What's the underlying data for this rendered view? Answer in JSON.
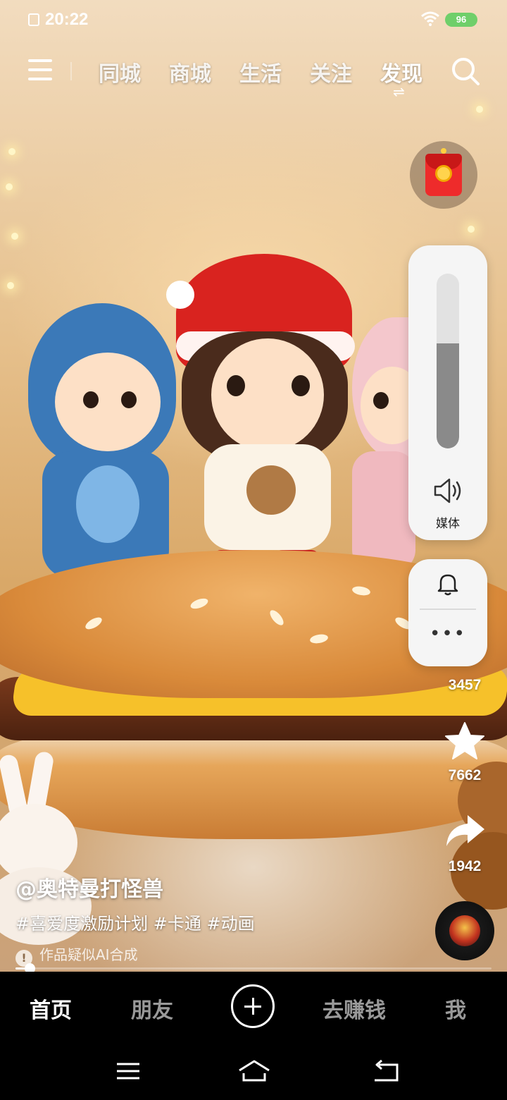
{
  "status_bar": {
    "time": "20:22",
    "battery": "96"
  },
  "top_nav": {
    "tabs": [
      {
        "label": "同城"
      },
      {
        "label": "商城"
      },
      {
        "label": "生活"
      },
      {
        "label": "关注"
      },
      {
        "label": "发现"
      }
    ],
    "active_tab": "发现"
  },
  "volume_panel": {
    "label": "媒体",
    "level": 0.6
  },
  "actions": {
    "count_1": "3457",
    "collect_count": "7662",
    "share_count": "1942"
  },
  "video_info": {
    "author": "@奥特曼打怪兽",
    "tags": "#喜爱度激励计划 #卡通 #动画",
    "ai_notice": "作品疑似AI合成",
    "progress": 0.03
  },
  "bottom_tabs": {
    "home": "首页",
    "friends": "朋友",
    "earn": "去赚钱",
    "me": "我"
  }
}
